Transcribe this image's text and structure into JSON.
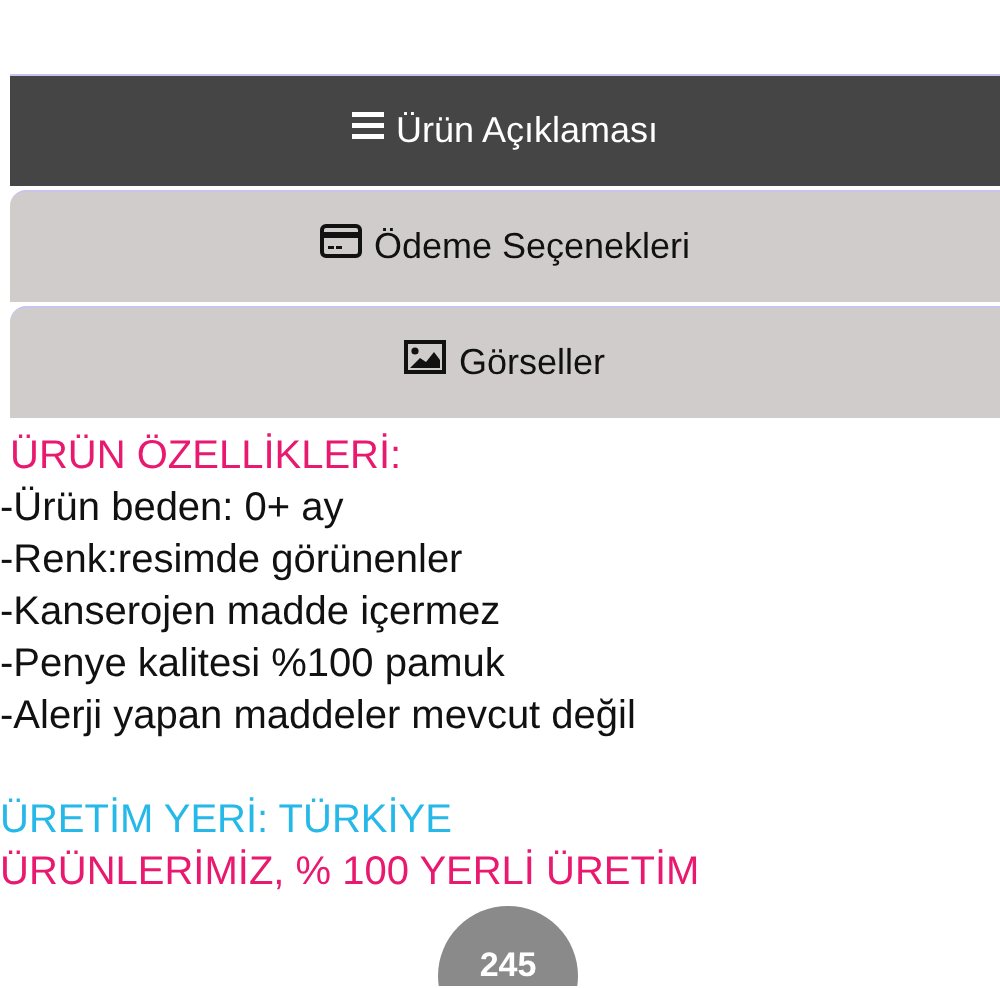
{
  "tabs": [
    {
      "label": "Ürün Açıklaması",
      "kind": "menu",
      "selected": true
    },
    {
      "label": "Ödeme Seçenekleri",
      "kind": "card",
      "selected": false
    },
    {
      "label": "Görseller",
      "kind": "image",
      "selected": false
    }
  ],
  "description": [
    {
      "kind": "heading",
      "text": "ÜRÜN ÖZELLİKLERİ:"
    },
    {
      "kind": "item",
      "text": "-Ürün beden: 0+ ay"
    },
    {
      "kind": "item",
      "text": "-Renk:resimde görünenler"
    },
    {
      "kind": "item",
      "text": "-Kanserojen madde içermez"
    },
    {
      "kind": "item",
      "text": "-Penye kalitesi %100 pamuk"
    },
    {
      "kind": "item",
      "text": "-Alerji yapan maddeler mevcut değil"
    },
    {
      "kind": "origin",
      "text": "ÜRETİM YERİ: TÜRKİYE"
    },
    {
      "kind": "slogan",
      "text": "ÜRÜNLERİMİZ, % 100 YERLİ ÜRETİM"
    }
  ],
  "counter_badge": "245"
}
